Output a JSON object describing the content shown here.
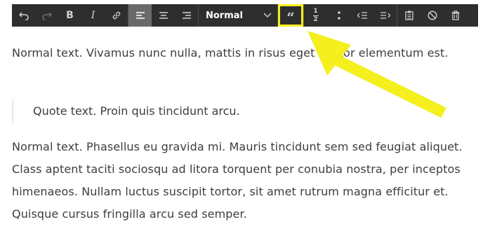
{
  "toolbar": {
    "buttons": [
      {
        "name": "undo",
        "icon": "undo-icon"
      },
      {
        "name": "redo",
        "icon": "redo-icon"
      },
      {
        "name": "bold",
        "icon": "bold-icon",
        "glyph": "B"
      },
      {
        "name": "italic",
        "icon": "italic-icon",
        "glyph": "I"
      },
      {
        "name": "link",
        "icon": "link-icon"
      },
      {
        "name": "align-left",
        "icon": "align-left-icon",
        "active": true
      },
      {
        "name": "align-center",
        "icon": "align-center-icon"
      },
      {
        "name": "align-right",
        "icon": "align-right-icon"
      },
      {
        "name": "blockquote",
        "icon": "blockquote-icon",
        "glyph": "“"
      },
      {
        "name": "ordered-list",
        "icon": "ordered-list-icon",
        "glyph_top": "1",
        "glyph_bottom": "2"
      },
      {
        "name": "unordered-list",
        "icon": "unordered-list-icon"
      },
      {
        "name": "outdent",
        "icon": "outdent-icon"
      },
      {
        "name": "indent",
        "icon": "indent-icon"
      },
      {
        "name": "paste",
        "icon": "clipboard-icon"
      },
      {
        "name": "clear-formatting",
        "icon": "clear-format-icon"
      },
      {
        "name": "delete",
        "icon": "trash-icon"
      }
    ],
    "format_select": {
      "value": "Normal",
      "icon": "chevron-down-icon"
    },
    "highlight_color": "#f4ef1d",
    "background": "#2e2e2e"
  },
  "content": {
    "paragraph1": "Normal text. Vivamus nunc nulla, mattis in risus eget auctor elementum est.",
    "quote": "Quote text. Proin quis tincidunt arcu.",
    "paragraph2": "Normal text. Phasellus eu gravida mi. Mauris tincidunt sem sed feugiat aliquet. Class aptent taciti sociosqu ad litora torquent per conubia nostra, per inceptos himenaeos. Nullam luctus suscipit tortor, sit amet rutrum magna efficitur et. Quisque cursus fringilla arcu sed semper."
  },
  "annotation": {
    "type": "arrow",
    "target": "blockquote",
    "color": "#f4ef1d"
  }
}
